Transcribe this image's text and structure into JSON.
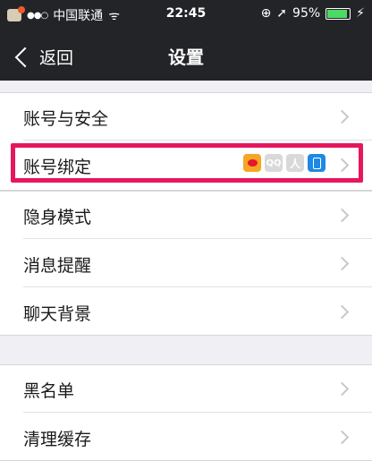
{
  "status_bar": {
    "carrier": "中国联通",
    "signal": "●●○",
    "wifi_symbol": "ᯤ",
    "time": "22:45",
    "lock_symbol": "⊕",
    "location_symbol": "➚",
    "battery_percent": "95%",
    "battery_level": 0.95,
    "charging_symbol": "⚡"
  },
  "nav": {
    "back_label": "返回",
    "title": "设置"
  },
  "groups": [
    {
      "items": [
        {
          "label": "账号与安全"
        },
        {
          "label": "账号绑定"
        }
      ]
    },
    {
      "items": [
        {
          "label": "隐身模式"
        },
        {
          "label": "消息提醒"
        },
        {
          "label": "聊天背景"
        }
      ]
    },
    {
      "items": [
        {
          "label": "黑名单"
        },
        {
          "label": "清理缓存"
        }
      ]
    }
  ],
  "binding_icons": [
    "weibo-icon",
    "qq-icon",
    "renren-icon",
    "phone-icon"
  ],
  "binding_icon_text": {
    "qq": "QQ",
    "renren": "人"
  },
  "colors": {
    "nav_background": "#232427",
    "highlight_border": "#e5175e",
    "chevron": "#c7c7cc",
    "page_background": "#efeff4"
  }
}
